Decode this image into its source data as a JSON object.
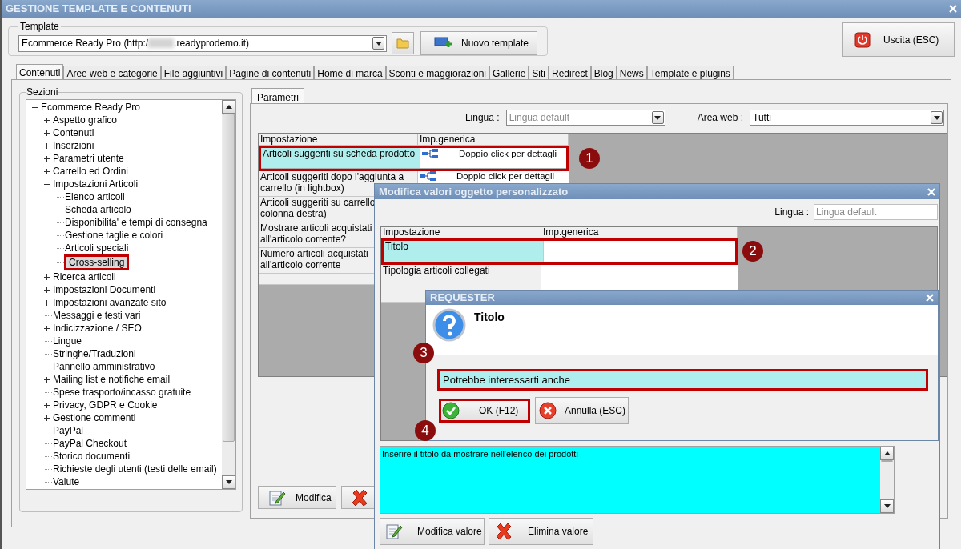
{
  "window": {
    "title": "GESTIONE TEMPLATE E CONTENUTI"
  },
  "template": {
    "legend": "Template",
    "value_start": "Ecommerce Ready Pro (http:/",
    "value_end": ".readyprodemo.it)",
    "new_button": "Nuovo template"
  },
  "exit_button": "Uscita (ESC)",
  "tabs": [
    {
      "label": "Contenuti",
      "selected": true
    },
    {
      "label": "Aree web e categorie",
      "selected": false
    },
    {
      "label": "File aggiuntivi",
      "selected": false
    },
    {
      "label": "Pagine di contenuti",
      "selected": false
    },
    {
      "label": "Home di marca",
      "selected": false
    },
    {
      "label": "Sconti e maggiorazioni",
      "selected": false
    },
    {
      "label": "Gallerie",
      "selected": false
    },
    {
      "label": "Siti",
      "selected": false
    },
    {
      "label": "Redirect",
      "selected": false
    },
    {
      "label": "Blog",
      "selected": false
    },
    {
      "label": "News",
      "selected": false
    },
    {
      "label": "Template e plugins",
      "selected": false
    }
  ],
  "sections": {
    "legend": "Sezioni",
    "tree": [
      {
        "label": "Ecommerce Ready Pro",
        "selected": false,
        "expanded": true,
        "children": [
          {
            "label": "Aspetto grafico",
            "selected": false,
            "expanded": false
          },
          {
            "label": "Contenuti",
            "selected": false,
            "expanded": false
          },
          {
            "label": "Inserzioni",
            "selected": false,
            "expanded": false
          },
          {
            "label": "Parametri utente",
            "selected": false,
            "expanded": false
          },
          {
            "label": "Carrello ed Ordini",
            "selected": false,
            "expanded": false
          },
          {
            "label": "Impostazioni Articoli",
            "selected": false,
            "expanded": true,
            "children": [
              {
                "label": "Elenco articoli",
                "selected": false
              },
              {
                "label": "Scheda articolo",
                "selected": false
              },
              {
                "label": "Disponibilita' e tempi di consegna",
                "selected": false
              },
              {
                "label": "Gestione taglie e colori",
                "selected": false
              },
              {
                "label": "Articoli speciali",
                "selected": false
              },
              {
                "label": "Cross-selling",
                "selected": true,
                "annotated": true
              }
            ]
          },
          {
            "label": "Ricerca articoli",
            "selected": false,
            "expanded": false
          },
          {
            "label": "Impostazioni Documenti",
            "selected": false,
            "expanded": false
          },
          {
            "label": "Impostazioni avanzate sito",
            "selected": false,
            "expanded": false
          },
          {
            "label": "Messaggi e testi vari",
            "selected": false
          },
          {
            "label": "Indicizzazione / SEO",
            "selected": false,
            "expanded": false
          },
          {
            "label": "Lingue",
            "selected": false
          },
          {
            "label": "Stringhe/Traduzioni",
            "selected": false
          },
          {
            "label": "Pannello amministrativo",
            "selected": false
          },
          {
            "label": "Mailing list e notifiche email",
            "selected": false,
            "expanded": false
          },
          {
            "label": "Spese trasporto/incasso gratuite",
            "selected": false
          },
          {
            "label": "Privacy, GDPR e Cookie",
            "selected": false,
            "expanded": false
          },
          {
            "label": "Gestione commenti",
            "selected": false,
            "expanded": false
          },
          {
            "label": "PayPal",
            "selected": false
          },
          {
            "label": "PayPal Checkout",
            "selected": false
          },
          {
            "label": "Storico documenti",
            "selected": false
          },
          {
            "label": "Richieste degli utenti (testi delle email)",
            "selected": false
          },
          {
            "label": "Valute",
            "selected": false
          }
        ]
      }
    ]
  },
  "subtabs": [
    {
      "label": "Parametri",
      "selected": true
    }
  ],
  "filters": {
    "lingua_label": "Lingua :",
    "lingua_value": "Lingua default",
    "lingua_disabled": true,
    "area_label": "Area web :",
    "area_value": "Tutti",
    "area_disabled": false
  },
  "table": {
    "columns": [
      "Impostazione",
      "Imp.generica"
    ],
    "rows": [
      {
        "setting": [
          "Articoli suggeriti su scheda prodotto"
        ],
        "value": "Doppio click per dettagli",
        "selected": true,
        "annotated": true,
        "marker": "1"
      },
      {
        "setting": [
          "Articoli suggeriti dopo l'aggiunta a",
          "carrello (in lightbox)"
        ],
        "value": "Doppio click per dettagli",
        "selected": false
      },
      {
        "setting": [
          "Articoli suggeriti su carrello",
          "colonna destra)"
        ],
        "selected": false
      },
      {
        "setting": [
          "Mostrare articoli acquistati",
          "all'articolo corrente?"
        ],
        "selected": false
      },
      {
        "setting": [
          "Numero articoli acquistati",
          "all'articolo corrente"
        ],
        "selected": false
      }
    ]
  },
  "bottom_buttons": [
    "Modifica"
  ],
  "dialog": {
    "title": "Modifica valori oggetto personalizzato",
    "lingua_label": "Lingua :",
    "lingua_value": "Lingua default",
    "lingua_disabled": true,
    "columns": [
      "Impostazione",
      "Imp.generica"
    ],
    "rows": [
      {
        "setting": "Titolo",
        "selected": true,
        "annotated": true,
        "marker": "2"
      },
      {
        "setting": "Tipologia articoli collegati",
        "selected": false
      }
    ],
    "description": "Inserire il titolo da mostrare nell'elenco dei prodotti",
    "buttons": [
      "Modifica valore",
      "Elimina valore"
    ]
  },
  "requester": {
    "title": "REQUESTER",
    "heading": "Titolo",
    "value": "Potrebbe interessarti anche",
    "field_marker": "3",
    "ok_button": "OK (F12)",
    "ok_marker": "4",
    "cancel_button": "Annulla (ESC)"
  }
}
